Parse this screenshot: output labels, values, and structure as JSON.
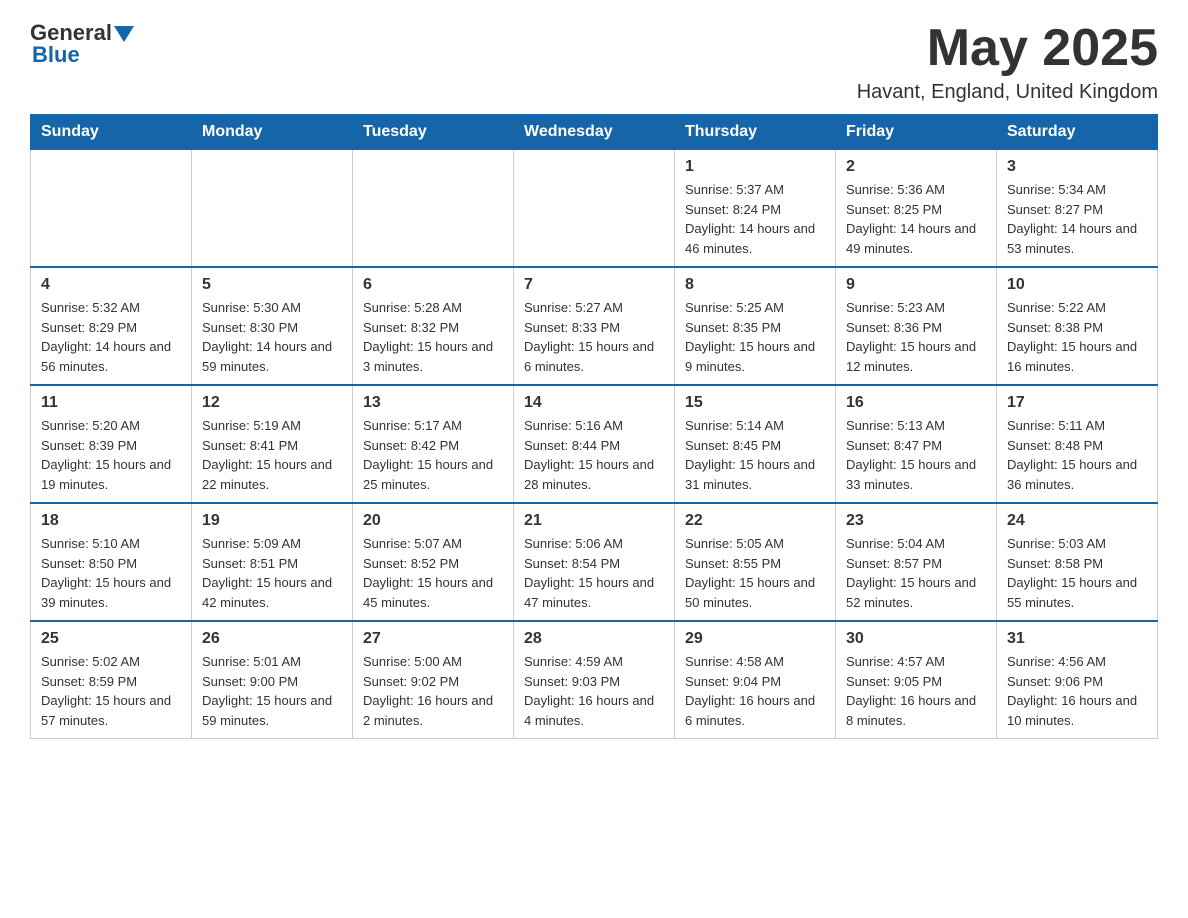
{
  "header": {
    "logo_general": "General",
    "logo_blue": "Blue",
    "month_title": "May 2025",
    "location": "Havant, England, United Kingdom"
  },
  "weekdays": [
    "Sunday",
    "Monday",
    "Tuesday",
    "Wednesday",
    "Thursday",
    "Friday",
    "Saturday"
  ],
  "weeks": [
    [
      {
        "day": "",
        "info": ""
      },
      {
        "day": "",
        "info": ""
      },
      {
        "day": "",
        "info": ""
      },
      {
        "day": "",
        "info": ""
      },
      {
        "day": "1",
        "info": "Sunrise: 5:37 AM\nSunset: 8:24 PM\nDaylight: 14 hours and 46 minutes."
      },
      {
        "day": "2",
        "info": "Sunrise: 5:36 AM\nSunset: 8:25 PM\nDaylight: 14 hours and 49 minutes."
      },
      {
        "day": "3",
        "info": "Sunrise: 5:34 AM\nSunset: 8:27 PM\nDaylight: 14 hours and 53 minutes."
      }
    ],
    [
      {
        "day": "4",
        "info": "Sunrise: 5:32 AM\nSunset: 8:29 PM\nDaylight: 14 hours and 56 minutes."
      },
      {
        "day": "5",
        "info": "Sunrise: 5:30 AM\nSunset: 8:30 PM\nDaylight: 14 hours and 59 minutes."
      },
      {
        "day": "6",
        "info": "Sunrise: 5:28 AM\nSunset: 8:32 PM\nDaylight: 15 hours and 3 minutes."
      },
      {
        "day": "7",
        "info": "Sunrise: 5:27 AM\nSunset: 8:33 PM\nDaylight: 15 hours and 6 minutes."
      },
      {
        "day": "8",
        "info": "Sunrise: 5:25 AM\nSunset: 8:35 PM\nDaylight: 15 hours and 9 minutes."
      },
      {
        "day": "9",
        "info": "Sunrise: 5:23 AM\nSunset: 8:36 PM\nDaylight: 15 hours and 12 minutes."
      },
      {
        "day": "10",
        "info": "Sunrise: 5:22 AM\nSunset: 8:38 PM\nDaylight: 15 hours and 16 minutes."
      }
    ],
    [
      {
        "day": "11",
        "info": "Sunrise: 5:20 AM\nSunset: 8:39 PM\nDaylight: 15 hours and 19 minutes."
      },
      {
        "day": "12",
        "info": "Sunrise: 5:19 AM\nSunset: 8:41 PM\nDaylight: 15 hours and 22 minutes."
      },
      {
        "day": "13",
        "info": "Sunrise: 5:17 AM\nSunset: 8:42 PM\nDaylight: 15 hours and 25 minutes."
      },
      {
        "day": "14",
        "info": "Sunrise: 5:16 AM\nSunset: 8:44 PM\nDaylight: 15 hours and 28 minutes."
      },
      {
        "day": "15",
        "info": "Sunrise: 5:14 AM\nSunset: 8:45 PM\nDaylight: 15 hours and 31 minutes."
      },
      {
        "day": "16",
        "info": "Sunrise: 5:13 AM\nSunset: 8:47 PM\nDaylight: 15 hours and 33 minutes."
      },
      {
        "day": "17",
        "info": "Sunrise: 5:11 AM\nSunset: 8:48 PM\nDaylight: 15 hours and 36 minutes."
      }
    ],
    [
      {
        "day": "18",
        "info": "Sunrise: 5:10 AM\nSunset: 8:50 PM\nDaylight: 15 hours and 39 minutes."
      },
      {
        "day": "19",
        "info": "Sunrise: 5:09 AM\nSunset: 8:51 PM\nDaylight: 15 hours and 42 minutes."
      },
      {
        "day": "20",
        "info": "Sunrise: 5:07 AM\nSunset: 8:52 PM\nDaylight: 15 hours and 45 minutes."
      },
      {
        "day": "21",
        "info": "Sunrise: 5:06 AM\nSunset: 8:54 PM\nDaylight: 15 hours and 47 minutes."
      },
      {
        "day": "22",
        "info": "Sunrise: 5:05 AM\nSunset: 8:55 PM\nDaylight: 15 hours and 50 minutes."
      },
      {
        "day": "23",
        "info": "Sunrise: 5:04 AM\nSunset: 8:57 PM\nDaylight: 15 hours and 52 minutes."
      },
      {
        "day": "24",
        "info": "Sunrise: 5:03 AM\nSunset: 8:58 PM\nDaylight: 15 hours and 55 minutes."
      }
    ],
    [
      {
        "day": "25",
        "info": "Sunrise: 5:02 AM\nSunset: 8:59 PM\nDaylight: 15 hours and 57 minutes."
      },
      {
        "day": "26",
        "info": "Sunrise: 5:01 AM\nSunset: 9:00 PM\nDaylight: 15 hours and 59 minutes."
      },
      {
        "day": "27",
        "info": "Sunrise: 5:00 AM\nSunset: 9:02 PM\nDaylight: 16 hours and 2 minutes."
      },
      {
        "day": "28",
        "info": "Sunrise: 4:59 AM\nSunset: 9:03 PM\nDaylight: 16 hours and 4 minutes."
      },
      {
        "day": "29",
        "info": "Sunrise: 4:58 AM\nSunset: 9:04 PM\nDaylight: 16 hours and 6 minutes."
      },
      {
        "day": "30",
        "info": "Sunrise: 4:57 AM\nSunset: 9:05 PM\nDaylight: 16 hours and 8 minutes."
      },
      {
        "day": "31",
        "info": "Sunrise: 4:56 AM\nSunset: 9:06 PM\nDaylight: 16 hours and 10 minutes."
      }
    ]
  ]
}
